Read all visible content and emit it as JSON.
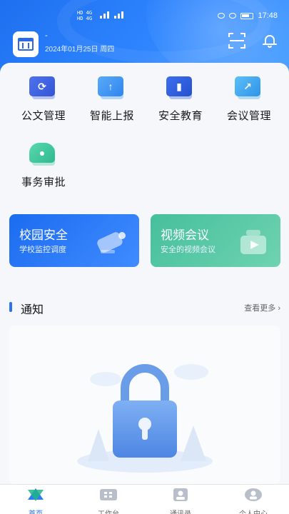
{
  "status_bar": {
    "left_text_1": "HD 4G",
    "left_text_2": "HD 4G",
    "time": "17:48"
  },
  "header": {
    "org_name": "-",
    "date": "2024年01月25日 周四",
    "icons": [
      "scan-icon",
      "bell-icon"
    ]
  },
  "quick_actions": [
    {
      "label": "公文管理",
      "icon": "document-refresh-icon",
      "color": "#3f63e0"
    },
    {
      "label": "智能上报",
      "icon": "upload-icon",
      "color": "#3b95f2"
    },
    {
      "label": "安全教育",
      "icon": "book-icon",
      "color": "#2f5fd9"
    },
    {
      "label": "会议管理",
      "icon": "chart-screen-icon",
      "color": "#3ca6ee"
    },
    {
      "label": "事务审批",
      "icon": "stamp-icon",
      "color": "#3cc59c"
    }
  ],
  "cards": [
    {
      "title": "校园安全",
      "subtitle": "学校监控调度",
      "icon": "camera-icon",
      "color": "#1c6cf0"
    },
    {
      "title": "视频会议",
      "subtitle": "安全的视频会议",
      "icon": "video-icon",
      "color": "#46bf9c"
    }
  ],
  "notice": {
    "title": "通知",
    "more": "查看更多 ›",
    "empty_illustration": "lock-icon"
  },
  "tabbar": [
    {
      "label": "首页",
      "icon": "home-icon",
      "active": true
    },
    {
      "label": "工作台",
      "icon": "workbench-icon",
      "active": false
    },
    {
      "label": "通讯录",
      "icon": "contacts-icon",
      "active": false
    },
    {
      "label": "个人中心",
      "icon": "profile-icon",
      "active": false
    }
  ]
}
